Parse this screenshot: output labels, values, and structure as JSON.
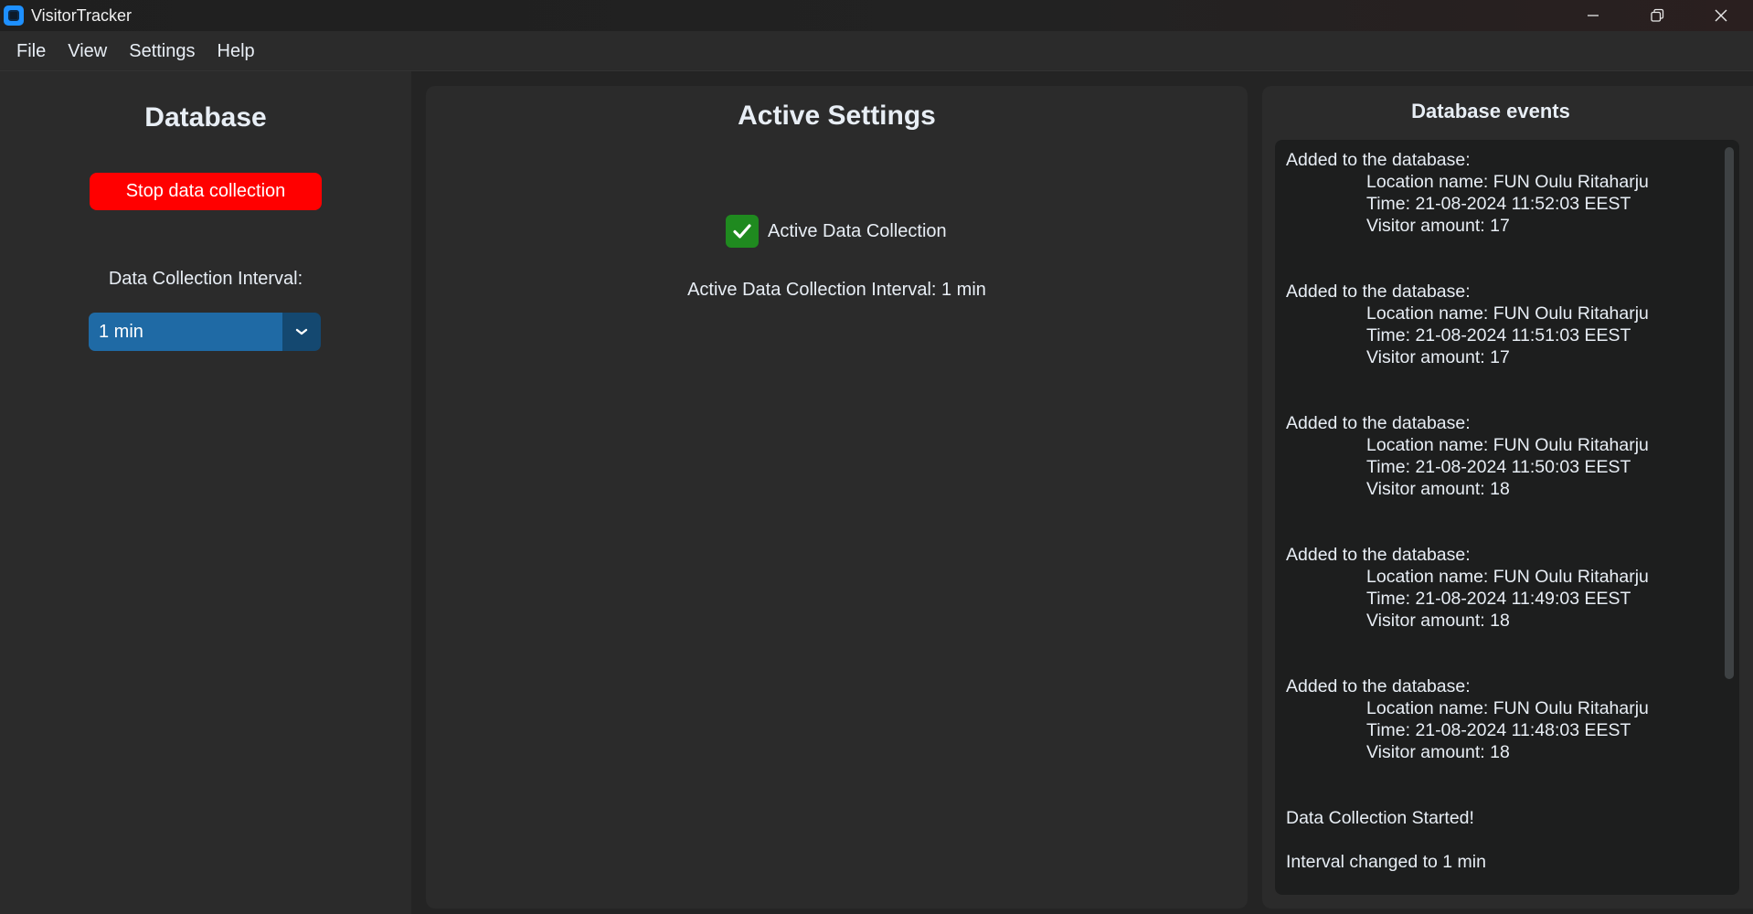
{
  "window": {
    "title": "VisitorTracker",
    "controls": {
      "minimize": "—",
      "maximize": "❐",
      "close": "✕"
    }
  },
  "menu": {
    "items": [
      "File",
      "View",
      "Settings",
      "Help"
    ]
  },
  "sidebar": {
    "title": "Database",
    "stop_button_label": "Stop data collection",
    "interval_label": "Data Collection Interval:",
    "interval_value": "1 min"
  },
  "active_settings": {
    "title": "Active Settings",
    "checkbox_label": "Active Data Collection",
    "checkbox_checked": true,
    "interval_text": "Active Data Collection Interval: 1 min"
  },
  "database_events": {
    "title": "Database events",
    "events": [
      {
        "head": "Added to the database:",
        "location": "Location name: FUN Oulu Ritaharju",
        "time": "Time: 21-08-2024 11:52:03 EEST",
        "visitors": "Visitor amount: 17"
      },
      {
        "head": "Added to the database:",
        "location": "Location name: FUN Oulu Ritaharju",
        "time": "Time: 21-08-2024 11:51:03 EEST",
        "visitors": "Visitor amount: 17"
      },
      {
        "head": "Added to the database:",
        "location": "Location name: FUN Oulu Ritaharju",
        "time": "Time: 21-08-2024 11:50:03 EEST",
        "visitors": "Visitor amount: 18"
      },
      {
        "head": "Added to the database:",
        "location": "Location name: FUN Oulu Ritaharju",
        "time": "Time: 21-08-2024 11:49:03 EEST",
        "visitors": "Visitor amount: 18"
      },
      {
        "head": "Added to the database:",
        "location": "Location name: FUN Oulu Ritaharju",
        "time": "Time: 21-08-2024 11:48:03 EEST",
        "visitors": "Visitor amount: 18"
      }
    ],
    "status_started": "Data Collection Started!",
    "status_interval": "Interval changed to 1 min"
  },
  "colors": {
    "stop_button": "#ff0000",
    "dropdown": "#1f6aa5",
    "dropdown_arrow": "#144870",
    "checkbox": "#1f8a1f",
    "app_icon": "#1e90ff"
  }
}
